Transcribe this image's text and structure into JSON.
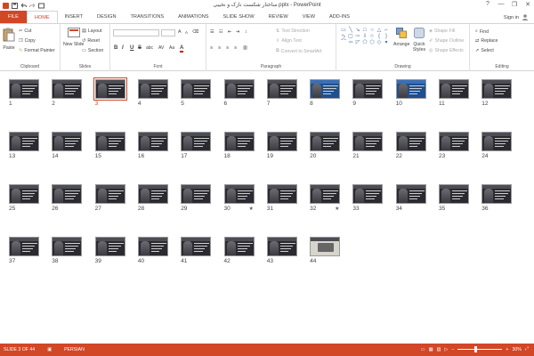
{
  "window": {
    "title": "ساختار شکست نازک و نخیبی.pptx - PowerPoint",
    "controls": [
      "?",
      "—",
      "❐",
      "✕"
    ]
  },
  "tabs": [
    {
      "label": "FILE",
      "kind": "file"
    },
    {
      "label": "HOME",
      "kind": "active"
    },
    {
      "label": "INSERT"
    },
    {
      "label": "DESIGN"
    },
    {
      "label": "TRANSITIONS"
    },
    {
      "label": "ANIMATIONS"
    },
    {
      "label": "SLIDE SHOW"
    },
    {
      "label": "REVIEW"
    },
    {
      "label": "VIEW"
    },
    {
      "label": "ADD-INS"
    }
  ],
  "signin": "Sign in",
  "ribbon": {
    "clipboard": {
      "label": "Clipboard",
      "paste": "Paste",
      "cut": "Cut",
      "copy": "Copy",
      "format_painter": "Format Painter"
    },
    "slides": {
      "label": "Slides",
      "new_slide": "New Slide",
      "layout": "Layout",
      "reset": "Reset",
      "section": "Section"
    },
    "font": {
      "label": "Font",
      "bold": "B",
      "italic": "I",
      "underline": "U",
      "strike": "S",
      "shadow": "abc",
      "spacing": "AV",
      "case": "Aa",
      "color": "A"
    },
    "paragraph": {
      "label": "Paragraph",
      "text_direction": "Text Direction",
      "align_text": "Align Text",
      "convert_smartart": "Convert to SmartArt"
    },
    "drawing": {
      "label": "Drawing",
      "arrange": "Arrange",
      "quick_styles": "Quick Styles",
      "shape_fill": "Shape Fill",
      "shape_outline": "Shape Outline",
      "shape_effects": "Shape Effects"
    },
    "editing": {
      "label": "Editing",
      "find": "Find",
      "replace": "Replace",
      "select": "Select"
    }
  },
  "slides": {
    "selected": 3,
    "items": [
      {
        "n": "1"
      },
      {
        "n": "2"
      },
      {
        "n": "3"
      },
      {
        "n": "4"
      },
      {
        "n": "5"
      },
      {
        "n": "6"
      },
      {
        "n": "7"
      },
      {
        "n": "8",
        "style": "blue"
      },
      {
        "n": "9"
      },
      {
        "n": "10",
        "style": "blue"
      },
      {
        "n": "11"
      },
      {
        "n": "12"
      },
      {
        "n": "13"
      },
      {
        "n": "14"
      },
      {
        "n": "15"
      },
      {
        "n": "16"
      },
      {
        "n": "17"
      },
      {
        "n": "18"
      },
      {
        "n": "19"
      },
      {
        "n": "20"
      },
      {
        "n": "21"
      },
      {
        "n": "22"
      },
      {
        "n": "23"
      },
      {
        "n": "24"
      },
      {
        "n": "25"
      },
      {
        "n": "26"
      },
      {
        "n": "27"
      },
      {
        "n": "28"
      },
      {
        "n": "29"
      },
      {
        "n": "30",
        "star": "★"
      },
      {
        "n": "31"
      },
      {
        "n": "32",
        "star": "★"
      },
      {
        "n": "33"
      },
      {
        "n": "34"
      },
      {
        "n": "35"
      },
      {
        "n": "36"
      },
      {
        "n": "37"
      },
      {
        "n": "38"
      },
      {
        "n": "39"
      },
      {
        "n": "40"
      },
      {
        "n": "41"
      },
      {
        "n": "42"
      },
      {
        "n": "43"
      },
      {
        "n": "44",
        "style": "photo"
      }
    ]
  },
  "status": {
    "slide_info": "SLIDE 3 OF 44",
    "language": "PERSIAN",
    "zoom_percent": "30%",
    "zoom_minus": "−",
    "zoom_plus": "+",
    "zoom_level": 0.3
  }
}
